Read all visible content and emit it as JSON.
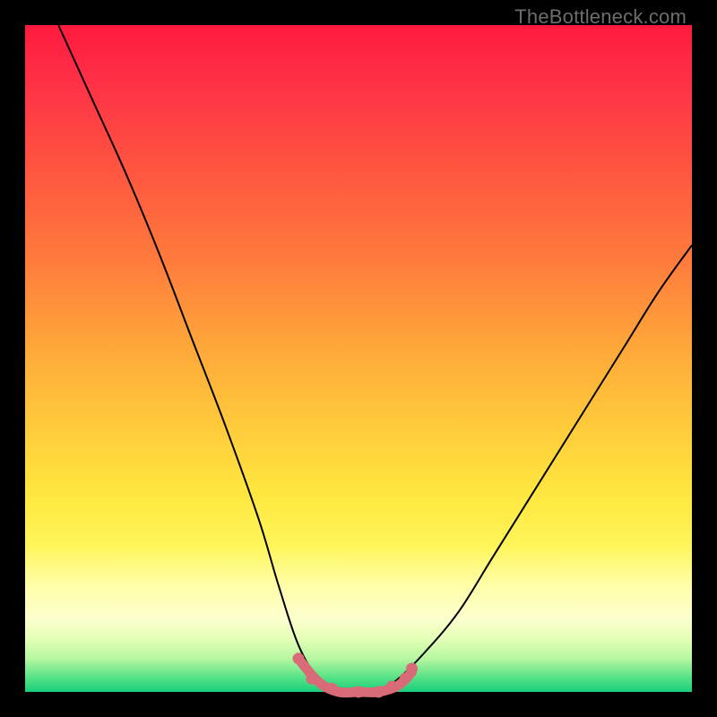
{
  "watermark": "TheBottleneck.com",
  "chart_data": {
    "type": "line",
    "title": "",
    "xlabel": "",
    "ylabel": "",
    "xlim": [
      0,
      100
    ],
    "ylim": [
      0,
      100
    ],
    "series": [
      {
        "name": "bottleneck-curve",
        "x": [
          5,
          10,
          15,
          20,
          25,
          30,
          35,
          38,
          41,
          44,
          47,
          50,
          53,
          56,
          60,
          65,
          70,
          75,
          80,
          85,
          90,
          95,
          100
        ],
        "values": [
          100,
          89,
          78,
          66,
          53,
          40,
          26,
          16,
          7,
          2,
          0,
          0,
          0,
          2,
          6,
          12,
          20,
          28,
          36,
          44,
          52,
          60,
          67
        ]
      }
    ],
    "highlight": {
      "name": "optimal-range",
      "x": [
        41,
        44,
        47,
        50,
        53,
        56,
        58
      ],
      "values": [
        5,
        1.5,
        0,
        0,
        0,
        1,
        3
      ]
    },
    "highlight_dots": {
      "x": [
        41,
        43,
        46,
        50,
        53,
        55,
        57,
        58
      ],
      "values": [
        5,
        2,
        0.5,
        0,
        0,
        0.8,
        2,
        3.5
      ]
    }
  }
}
